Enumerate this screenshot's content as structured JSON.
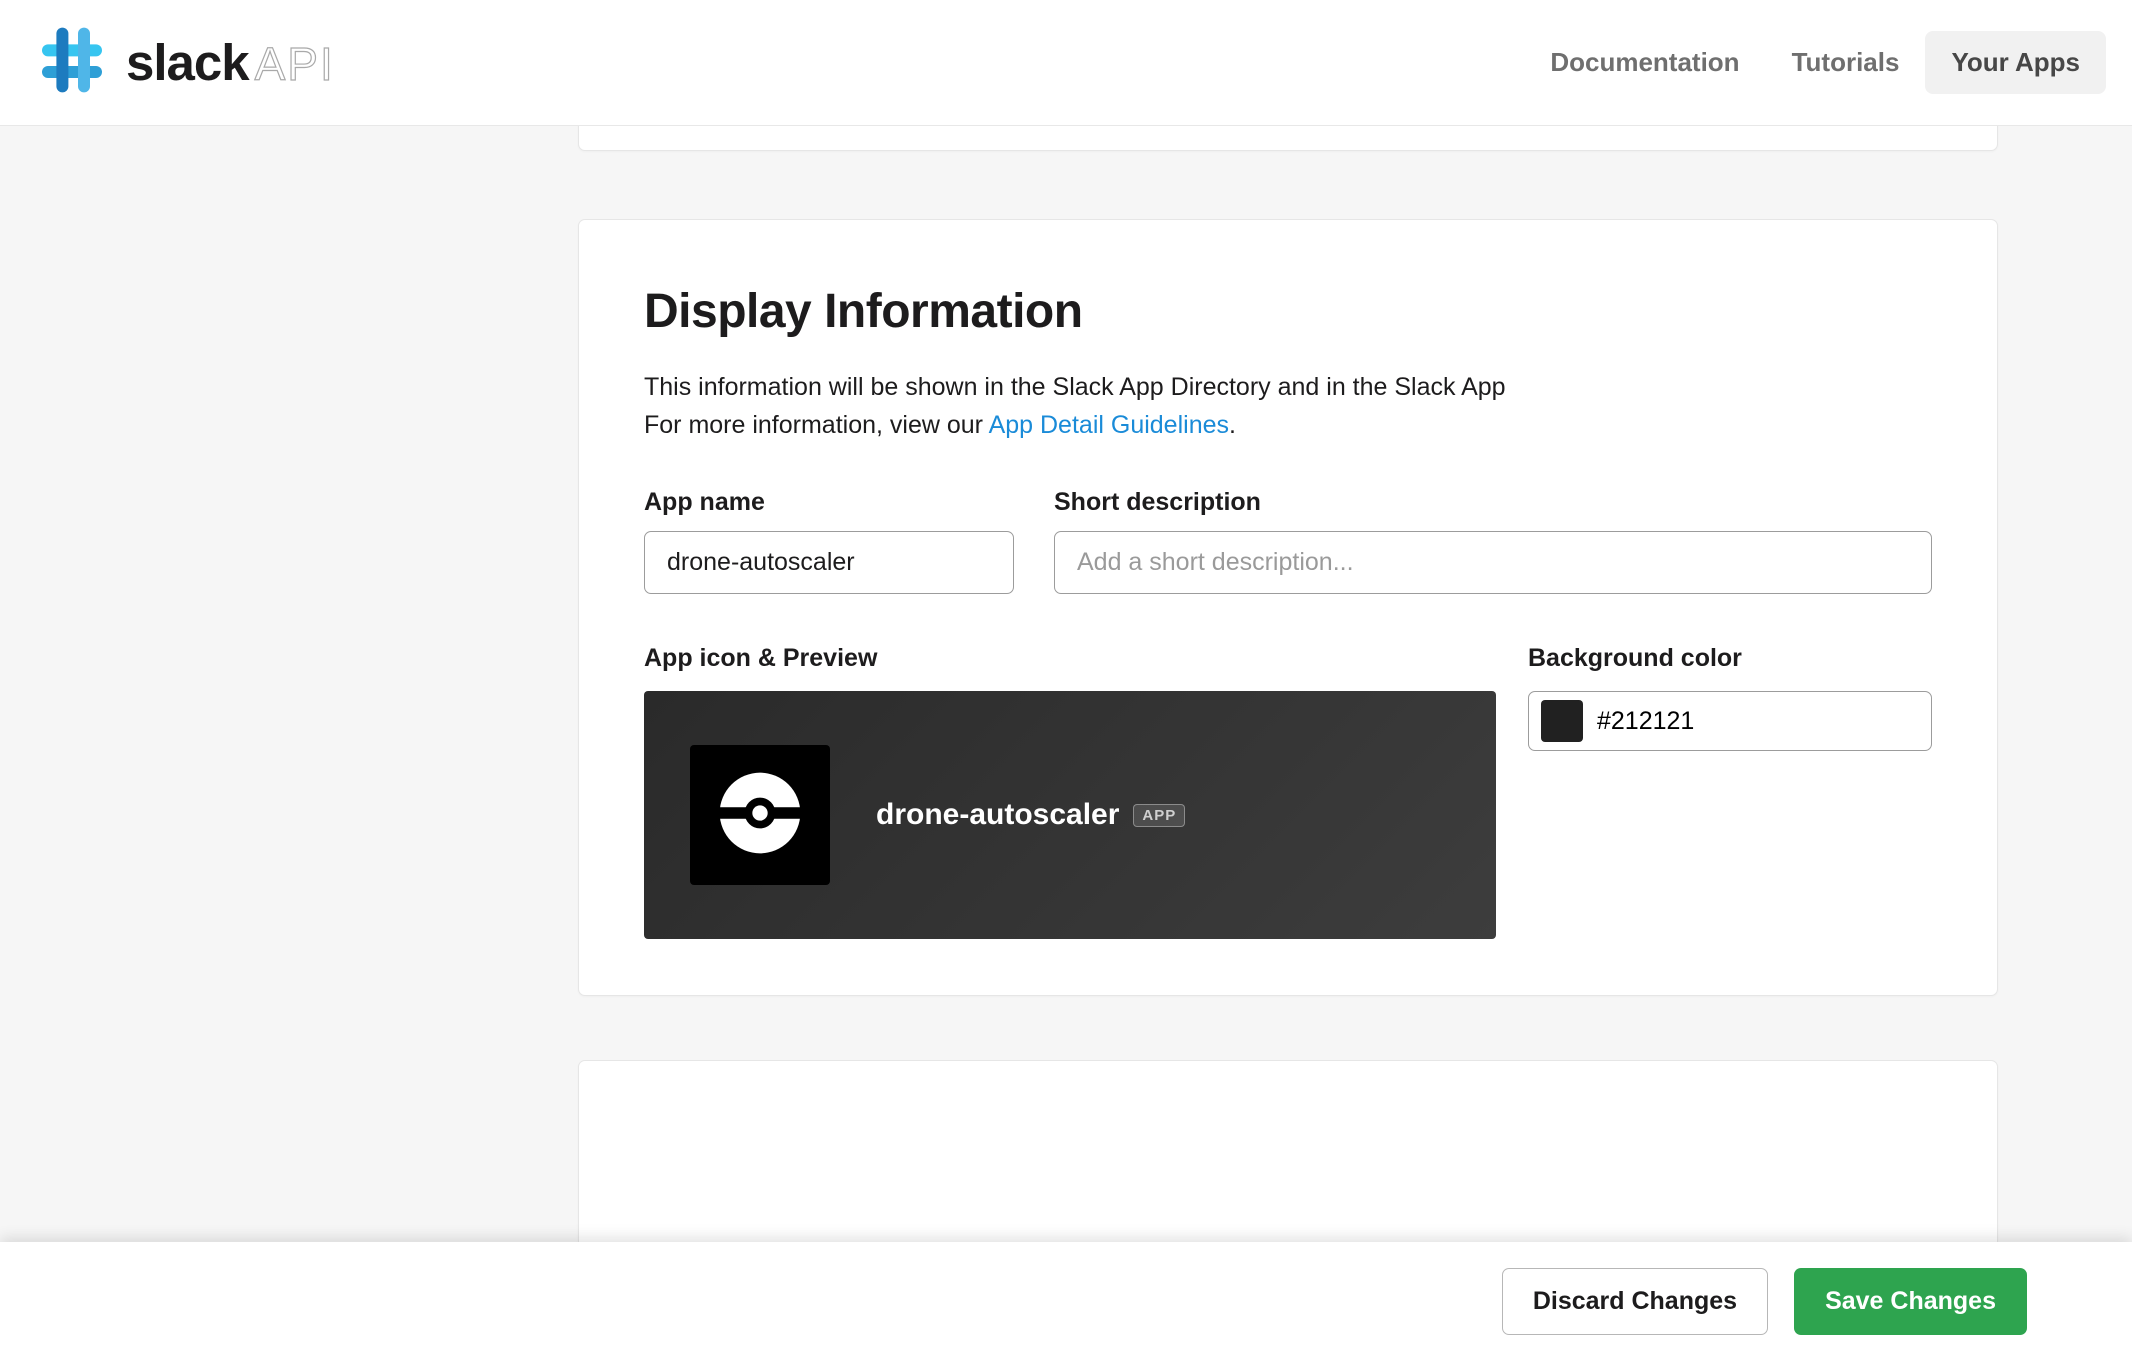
{
  "header": {
    "brand_word": "slack",
    "brand_suffix": "API",
    "nav": [
      {
        "label": "Documentation",
        "active": false
      },
      {
        "label": "Tutorials",
        "active": false
      },
      {
        "label": "Your Apps",
        "active": true
      }
    ]
  },
  "section": {
    "title": "Display Information",
    "intro_line1": "This information will be shown in the Slack App Directory and in the Slack App",
    "intro_line2_prefix": "For more information, view our ",
    "intro_link_text": "App Detail Guidelines",
    "intro_line2_suffix": "."
  },
  "form": {
    "app_name": {
      "label": "App name",
      "value": "drone-autoscaler"
    },
    "short_desc": {
      "label": "Short description",
      "value": "",
      "placeholder": "Add a short description..."
    },
    "preview": {
      "label": "App icon & Preview",
      "app_name": "drone-autoscaler",
      "badge": "APP"
    },
    "bg_color": {
      "label": "Background color",
      "value": "#212121",
      "swatch": "#212121"
    }
  },
  "footer": {
    "discard": "Discard Changes",
    "save": "Save Changes"
  }
}
